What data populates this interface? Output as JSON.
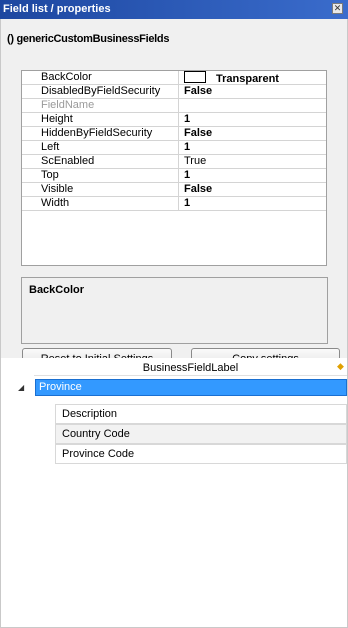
{
  "window": {
    "title": "Field list / properties"
  },
  "properties": {
    "object_name": "() genericCustomBusinessFields",
    "rows": [
      {
        "name": "BackColor",
        "value": "Transparent"
      },
      {
        "name": "DisabledByFieldSecurity",
        "value": "False"
      },
      {
        "name": "FieldName",
        "value": ""
      },
      {
        "name": "Height",
        "value": "1"
      },
      {
        "name": "HiddenByFieldSecurity",
        "value": "False"
      },
      {
        "name": "Left",
        "value": "1"
      },
      {
        "name": "ScEnabled",
        "value": "True"
      },
      {
        "name": "Top",
        "value": "1"
      },
      {
        "name": "Visible",
        "value": "False"
      },
      {
        "name": "Width",
        "value": "1"
      }
    ],
    "description_title": "BackColor",
    "reset_button": "Reset to Initial Settings",
    "copy_button": "Copy settings"
  },
  "tree": {
    "column_header": "BusinessFieldLabel",
    "root": {
      "label": "Province",
      "expanded": true
    },
    "children": [
      "Description",
      "Country Code",
      "Province Code"
    ]
  },
  "colors": {
    "title_bar": "#3a6ccc",
    "selection": "#3399ff"
  },
  "icons": {
    "close": "close-icon",
    "expand": "expanded-arrow-icon",
    "header": "pin-icon",
    "swatch": "color-swatch"
  }
}
